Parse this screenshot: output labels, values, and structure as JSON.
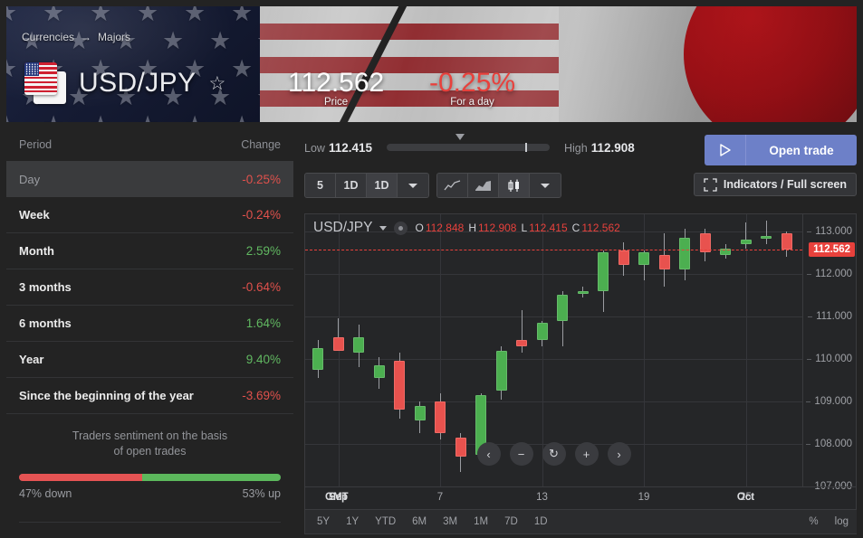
{
  "header": {
    "breadcrumb": [
      "Currencies",
      "Majors"
    ],
    "breadcrumb_arrow": "→",
    "symbol": "USD/JPY",
    "favorite_icon": "☆",
    "price": "112.562",
    "price_label": "Price",
    "change": "-0.25%",
    "change_label": "For a day",
    "change_color": "#e8413c"
  },
  "periods": {
    "col_period": "Period",
    "col_change": "Change",
    "rows": [
      {
        "name": "Day",
        "change": "-0.25%",
        "dir": "neg",
        "active": true
      },
      {
        "name": "Week",
        "change": "-0.24%",
        "dir": "neg",
        "active": false
      },
      {
        "name": "Month",
        "change": "2.59%",
        "dir": "pos",
        "active": false
      },
      {
        "name": "3 months",
        "change": "-0.64%",
        "dir": "neg",
        "active": false
      },
      {
        "name": "6 months",
        "change": "1.64%",
        "dir": "pos",
        "active": false
      },
      {
        "name": "Year",
        "change": "9.40%",
        "dir": "pos",
        "active": false
      },
      {
        "name": "Since the beginning of the year",
        "change": "-3.69%",
        "dir": "neg",
        "active": false
      }
    ]
  },
  "sentiment": {
    "title_line1": "Traders sentiment on the basis",
    "title_line2": "of open trades",
    "down_label": "47% down",
    "up_label": "53% up",
    "down_pct": 47,
    "up_pct": 53,
    "down_color": "#e55353",
    "up_color": "#5cb85c"
  },
  "range": {
    "low_label": "Low",
    "low_value": "112.415",
    "high_label": "High",
    "high_value": "112.908",
    "marker_pct": 45,
    "tick_pct": 85
  },
  "actions": {
    "open_trade": "Open trade",
    "open_trade_color": "#6d80c8",
    "play_icon": "play-triangle-icon",
    "indicators": "Indicators / Full screen",
    "expand_icon": "expand-arrows-icon"
  },
  "toolbar": {
    "intervals": [
      "5",
      "1D",
      "1D"
    ],
    "interval_more_icon": "chevron-down-icon",
    "chart_types": [
      "line-chart-icon",
      "area-chart-icon",
      "candlestick-chart-icon"
    ],
    "active_chart_type": 2,
    "type_more_icon": "chevron-down-icon"
  },
  "chart_header": {
    "symbol": "USD/JPY",
    "dropdown_icon": "chevron-down-icon",
    "eye_icon": "eye-icon",
    "o_label": "O",
    "o_value": "112.848",
    "h_label": "H",
    "h_value": "112.908",
    "l_label": "L",
    "l_value": "112.415",
    "c_label": "C",
    "c_value": "112.562",
    "value_color": "#e8413c"
  },
  "chart_nav": {
    "scroll_left": "‹",
    "zoom_out": "−",
    "reset": "↻",
    "zoom_in": "+",
    "scroll_right": "›"
  },
  "bottom_bar": {
    "ranges": [
      "5Y",
      "1Y",
      "YTD",
      "6M",
      "3M",
      "1M",
      "7D",
      "1D"
    ],
    "scale_pct": "%",
    "scale_log": "log"
  },
  "chart_data": {
    "type": "candlestick",
    "title": "USD/JPY",
    "xlabel": "",
    "ylabel": "",
    "timezone": "GMT",
    "ylim": [
      107.0,
      113.4
    ],
    "yticks": [
      "113.000",
      "112.000",
      "111.000",
      "110.000",
      "109.000",
      "108.000",
      "107.000"
    ],
    "ytick_values": [
      113.0,
      112.0,
      111.0,
      110.0,
      109.0,
      108.0,
      107.0
    ],
    "xticks": [
      "Sep",
      "7",
      "13",
      "19",
      "25",
      "Oct"
    ],
    "grid": true,
    "last_price": 112.562,
    "last_price_label": "112.562",
    "last_price_color": "#e8413c",
    "up_color": "#4caf50",
    "down_color": "#e8524e",
    "candles": [
      {
        "o": 109.75,
        "h": 110.45,
        "l": 109.55,
        "c": 110.25,
        "dir": "up"
      },
      {
        "o": 110.5,
        "h": 110.95,
        "l": 110.25,
        "c": 110.2,
        "dir": "down"
      },
      {
        "o": 110.15,
        "h": 110.8,
        "l": 109.8,
        "c": 110.5,
        "dir": "up"
      },
      {
        "o": 109.55,
        "h": 110.05,
        "l": 109.3,
        "c": 109.85,
        "dir": "up"
      },
      {
        "o": 109.95,
        "h": 110.15,
        "l": 108.6,
        "c": 108.8,
        "dir": "down"
      },
      {
        "o": 108.55,
        "h": 109.0,
        "l": 108.25,
        "c": 108.9,
        "dir": "up"
      },
      {
        "o": 109.0,
        "h": 109.2,
        "l": 108.1,
        "c": 108.25,
        "dir": "down"
      },
      {
        "o": 108.15,
        "h": 108.25,
        "l": 107.35,
        "c": 107.7,
        "dir": "down"
      },
      {
        "o": 107.75,
        "h": 109.2,
        "l": 107.7,
        "c": 109.15,
        "dir": "up"
      },
      {
        "o": 109.25,
        "h": 110.3,
        "l": 109.05,
        "c": 110.2,
        "dir": "up"
      },
      {
        "o": 110.3,
        "h": 111.15,
        "l": 110.15,
        "c": 110.45,
        "dir": "down"
      },
      {
        "o": 110.45,
        "h": 110.9,
        "l": 110.3,
        "c": 110.85,
        "dir": "up"
      },
      {
        "o": 110.9,
        "h": 111.6,
        "l": 110.3,
        "c": 111.5,
        "dir": "up"
      },
      {
        "o": 111.55,
        "h": 111.7,
        "l": 111.45,
        "c": 111.6,
        "dir": "up"
      },
      {
        "o": 111.6,
        "h": 112.55,
        "l": 111.1,
        "c": 112.5,
        "dir": "up"
      },
      {
        "o": 112.55,
        "h": 112.75,
        "l": 111.95,
        "c": 112.2,
        "dir": "down"
      },
      {
        "o": 112.2,
        "h": 112.55,
        "l": 111.85,
        "c": 112.5,
        "dir": "up"
      },
      {
        "o": 112.45,
        "h": 112.95,
        "l": 111.7,
        "c": 112.1,
        "dir": "down"
      },
      {
        "o": 112.1,
        "h": 113.05,
        "l": 111.85,
        "c": 112.85,
        "dir": "up"
      },
      {
        "o": 112.95,
        "h": 113.05,
        "l": 112.3,
        "c": 112.5,
        "dir": "down"
      },
      {
        "o": 112.45,
        "h": 112.7,
        "l": 112.35,
        "c": 112.6,
        "dir": "up"
      },
      {
        "o": 112.7,
        "h": 113.2,
        "l": 112.6,
        "c": 112.8,
        "dir": "up"
      },
      {
        "o": 112.85,
        "h": 113.25,
        "l": 112.7,
        "c": 112.9,
        "dir": "up"
      },
      {
        "o": 112.95,
        "h": 113.0,
        "l": 112.4,
        "c": 112.56,
        "dir": "down"
      }
    ]
  }
}
